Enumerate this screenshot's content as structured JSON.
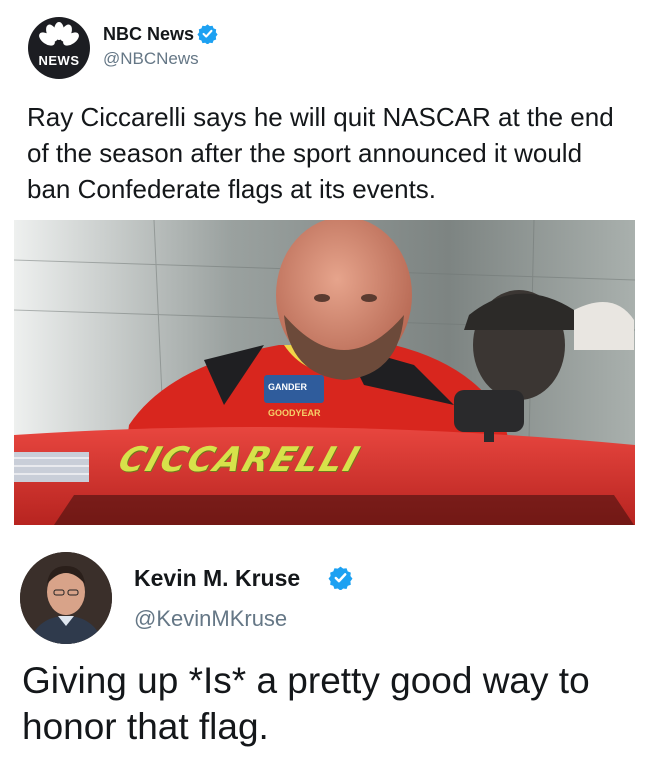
{
  "tweet1": {
    "display_name": "NBC News",
    "handle": "@NBCNews",
    "avatar_label": "NEWS",
    "verified": true,
    "text": "Ray Ciccarelli says he will quit NASCAR at the end of the season after the sport announced it would ban Confederate flags at its events.",
    "photo": {
      "car_lettering": "CICCARELLI",
      "patch_text": "GANDER",
      "sponsor_text": "GOODYEAR"
    }
  },
  "tweet2": {
    "display_name": "Kevin M. Kruse",
    "handle": "@KevinMKruse",
    "verified": true,
    "text": "Giving up *Is* a pretty good way to honor that flag."
  },
  "colors": {
    "verified_blue": "#1da1f2",
    "handle_gray": "#657786",
    "text_dark": "#14171a"
  }
}
